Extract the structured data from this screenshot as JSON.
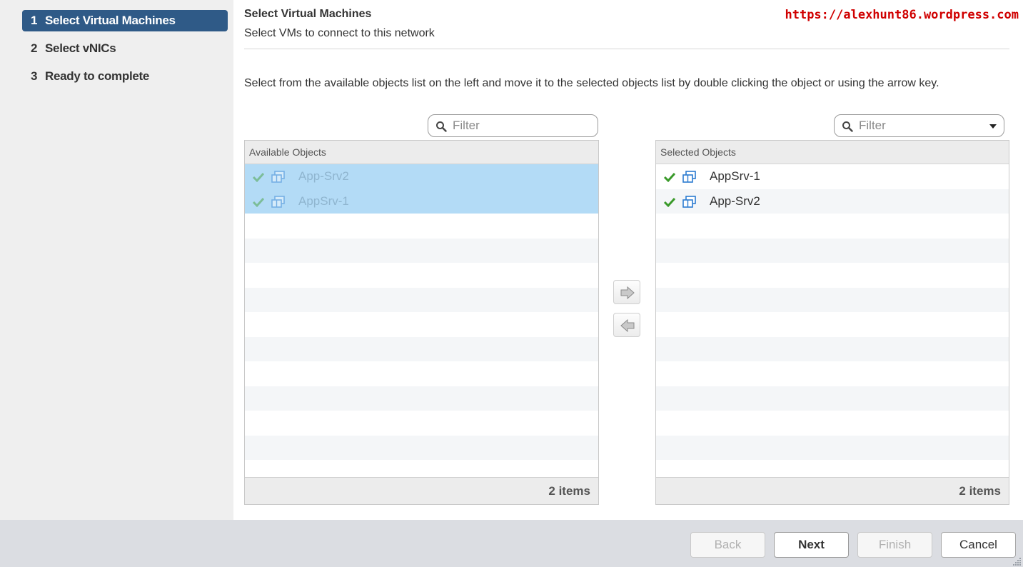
{
  "sidebar": {
    "steps": [
      {
        "num": "1",
        "label": "Select Virtual Machines"
      },
      {
        "num": "2",
        "label": "Select vNICs"
      },
      {
        "num": "3",
        "label": "Ready to complete"
      }
    ],
    "active_step": 1
  },
  "header": {
    "title": "Select Virtual Machines",
    "subtitle": "Select VMs to connect to this network",
    "watermark": "https://alexhunt86.wordpress.com"
  },
  "instructions": "Select from the available objects list on the left and move it to the selected objects list by double clicking the object or using the arrow key.",
  "available": {
    "filter_placeholder": "Filter",
    "header": "Available Objects",
    "items": [
      "App-Srv2",
      "AppSrv-1"
    ],
    "footer": "2 items"
  },
  "selected": {
    "filter_placeholder": "Filter",
    "header": "Selected Objects",
    "items": [
      "AppSrv-1",
      "App-Srv2"
    ],
    "footer": "2 items"
  },
  "buttons": {
    "back": "Back",
    "next": "Next",
    "finish": "Finish",
    "cancel": "Cancel"
  },
  "colors": {
    "active_step_bg": "#2f5a87",
    "selection_bg": "#b3dbf6",
    "check_green": "#3a9a2a",
    "vm_blue": "#2b7bd0",
    "watermark_red": "#d00000",
    "footer_bg": "#dbdde2"
  },
  "icons": {
    "filter": "search-icon",
    "move_right": "arrow-right-icon",
    "move_left": "arrow-left-icon",
    "status": "check-icon",
    "vm": "virtual-machine-icon",
    "dropdown": "caret-down-icon"
  }
}
